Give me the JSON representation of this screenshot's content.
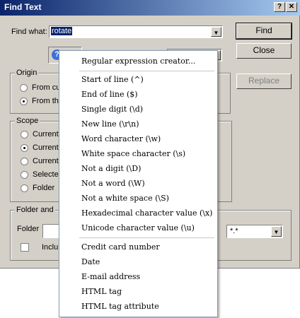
{
  "window": {
    "title": "Find Text",
    "help_glyph": "?",
    "close_glyph": "✕"
  },
  "find_what": {
    "label": "Find what:",
    "value": "rotate"
  },
  "buttons": {
    "find": "Find",
    "close": "Close",
    "replace": "Replace"
  },
  "origin": {
    "title": "Origin",
    "option1": "From cu",
    "option2": "From the"
  },
  "scope": {
    "title": "Scope",
    "option1": "Current",
    "option2": "Current",
    "option3": "Current",
    "option4": "Selecte",
    "option5": "Folder"
  },
  "folder_group": {
    "title": "Folder and",
    "folder_label": "Folder",
    "include_label": "Inclu",
    "mask_value": "*.*"
  },
  "menu": {
    "item0": "Regular expression creator...",
    "item1": "Start of line (^)",
    "item2": "End of line ($)",
    "item3": "Single digit (\\d)",
    "item4": "New line (\\r\\n)",
    "item5": "Word character (\\w)",
    "item6": "White space character (\\s)",
    "item7": "Not a digit (\\D)",
    "item8": "Not a word (\\W)",
    "item9": "Not a white space (\\S)",
    "item10": "Hexadecimal character value (\\x)",
    "item11": "Unicode character value (\\u)",
    "item12": "Credit card number",
    "item13": "Date",
    "item14": "E-mail address",
    "item15": "HTML tag",
    "item16": "HTML tag attribute"
  },
  "icons": [
    "help-circle-icon",
    "search-icon",
    "dropdown-arrow-icon"
  ],
  "colors": {
    "title_start": "#0a246a",
    "title_end": "#a6caf0",
    "face": "#d4d0c8",
    "selection": "#0a246a"
  }
}
